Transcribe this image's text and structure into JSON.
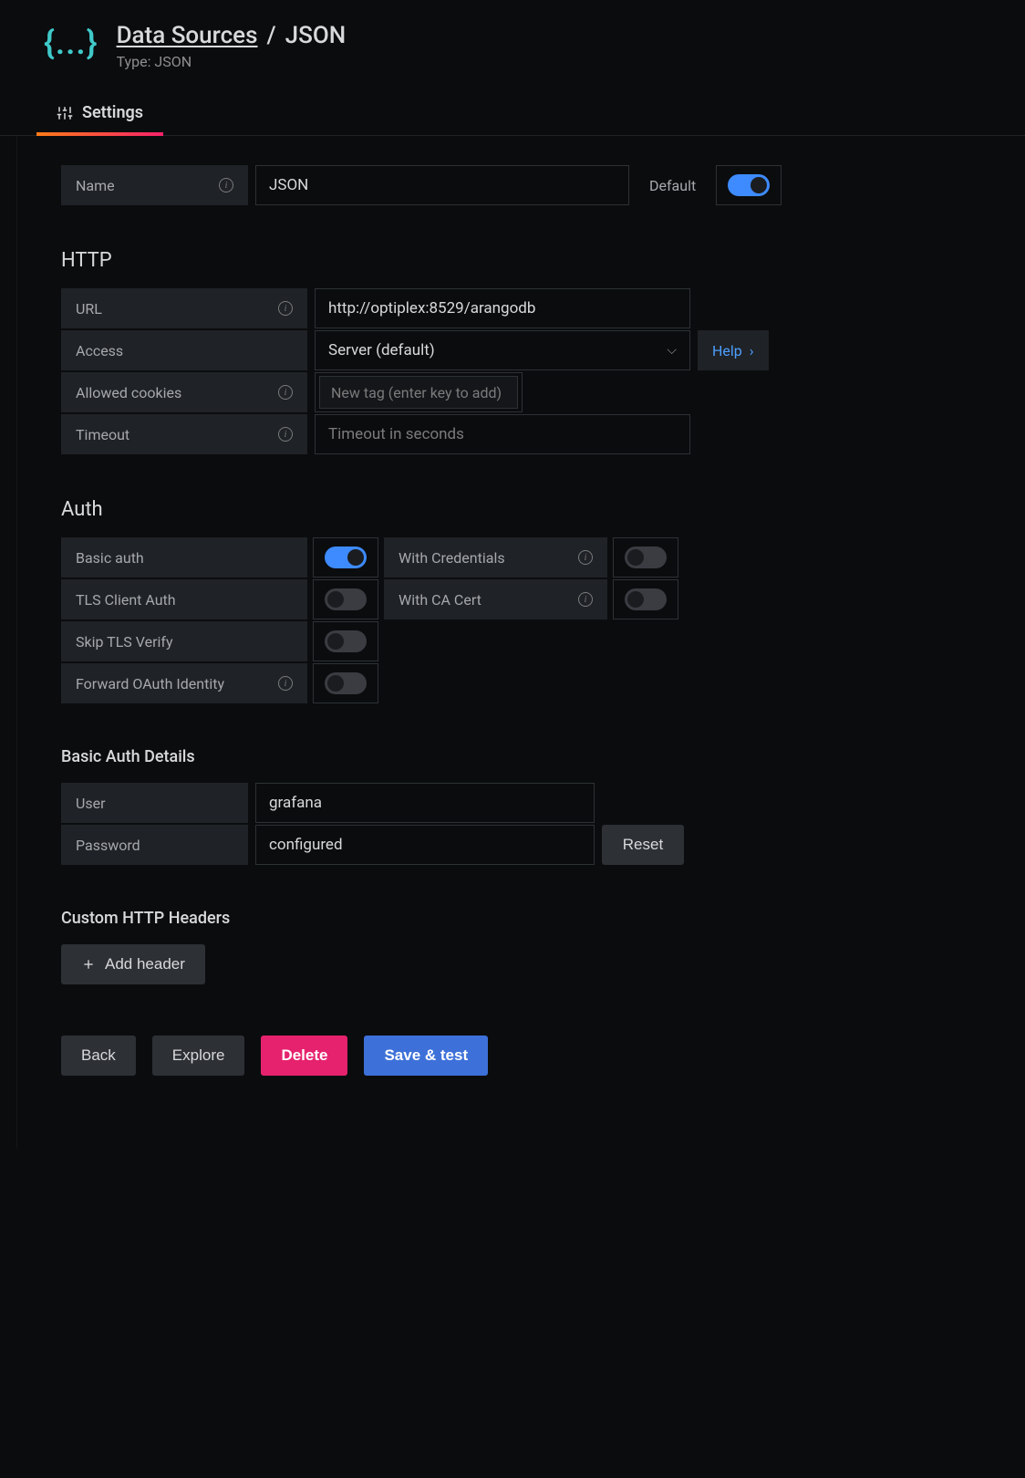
{
  "breadcrumb": {
    "parent": "Data Sources",
    "separator": "/",
    "current": "JSON",
    "subtitle": "Type: JSON"
  },
  "tabs": {
    "settings": "Settings"
  },
  "form": {
    "name_label": "Name",
    "name_value": "JSON",
    "default_label": "Default"
  },
  "http": {
    "section_title": "HTTP",
    "url_label": "URL",
    "url_value": "http://optiplex:8529/arangodb",
    "access_label": "Access",
    "access_value": "Server (default)",
    "help_label": "Help",
    "cookies_label": "Allowed cookies",
    "cookies_placeholder": "New tag (enter key to add)",
    "timeout_label": "Timeout",
    "timeout_placeholder": "Timeout in seconds"
  },
  "auth": {
    "section_title": "Auth",
    "basic_auth": "Basic auth",
    "with_credentials": "With Credentials",
    "tls_client_auth": "TLS Client Auth",
    "with_ca_cert": "With CA Cert",
    "skip_tls_verify": "Skip TLS Verify",
    "forward_oauth": "Forward OAuth Identity"
  },
  "basic_auth_details": {
    "section_title": "Basic Auth Details",
    "user_label": "User",
    "user_value": "grafana",
    "password_label": "Password",
    "password_value": "configured",
    "reset_label": "Reset"
  },
  "custom_headers": {
    "section_title": "Custom HTTP Headers",
    "add_header": "Add header"
  },
  "buttons": {
    "back": "Back",
    "explore": "Explore",
    "delete": "Delete",
    "save_test": "Save & test"
  }
}
